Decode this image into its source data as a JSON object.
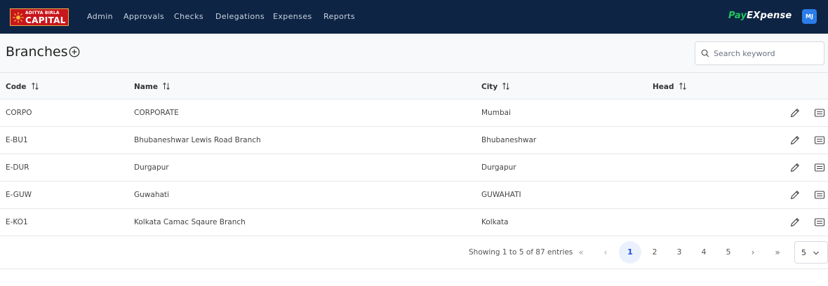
{
  "logo": {
    "line1": "ADITYA BIRLA",
    "line2": "CAPITAL",
    "color": "#c8161d"
  },
  "nav": {
    "items": [
      "Admin",
      "Approvals",
      "Checks",
      "Delegations",
      "Expenses",
      "Reports"
    ]
  },
  "brand": {
    "part1": "Pay",
    "part2": "EX",
    "part3": "pense",
    "accent": "#22c55e"
  },
  "user": {
    "initials": "MJ"
  },
  "page": {
    "title": "Branches",
    "add_icon": "plus-circle-icon"
  },
  "search": {
    "placeholder": "Search keyword",
    "value": ""
  },
  "table": {
    "columns": [
      "Code",
      "Name",
      "City",
      "Head"
    ],
    "rows": [
      {
        "code": "CORPO",
        "name": "CORPORATE",
        "city": "Mumbai",
        "head": ""
      },
      {
        "code": "E-BU1",
        "name": "Bhubaneshwar Lewis Road Branch",
        "city": "Bhubaneshwar",
        "head": ""
      },
      {
        "code": "E-DUR",
        "name": "Durgapur",
        "city": "Durgapur",
        "head": ""
      },
      {
        "code": "E-GUW",
        "name": "Guwahati",
        "city": "GUWAHATI",
        "head": ""
      },
      {
        "code": "E-KO1",
        "name": "Kolkata Camac Sqaure Branch",
        "city": "Kolkata",
        "head": ""
      }
    ]
  },
  "pagination": {
    "summary": "Showing 1 to 5 of 87 entries",
    "first": "«",
    "prev": "‹",
    "pages": [
      "1",
      "2",
      "3",
      "4",
      "5"
    ],
    "current": "1",
    "next": "›",
    "last": "»",
    "rows_per_page": "5"
  }
}
